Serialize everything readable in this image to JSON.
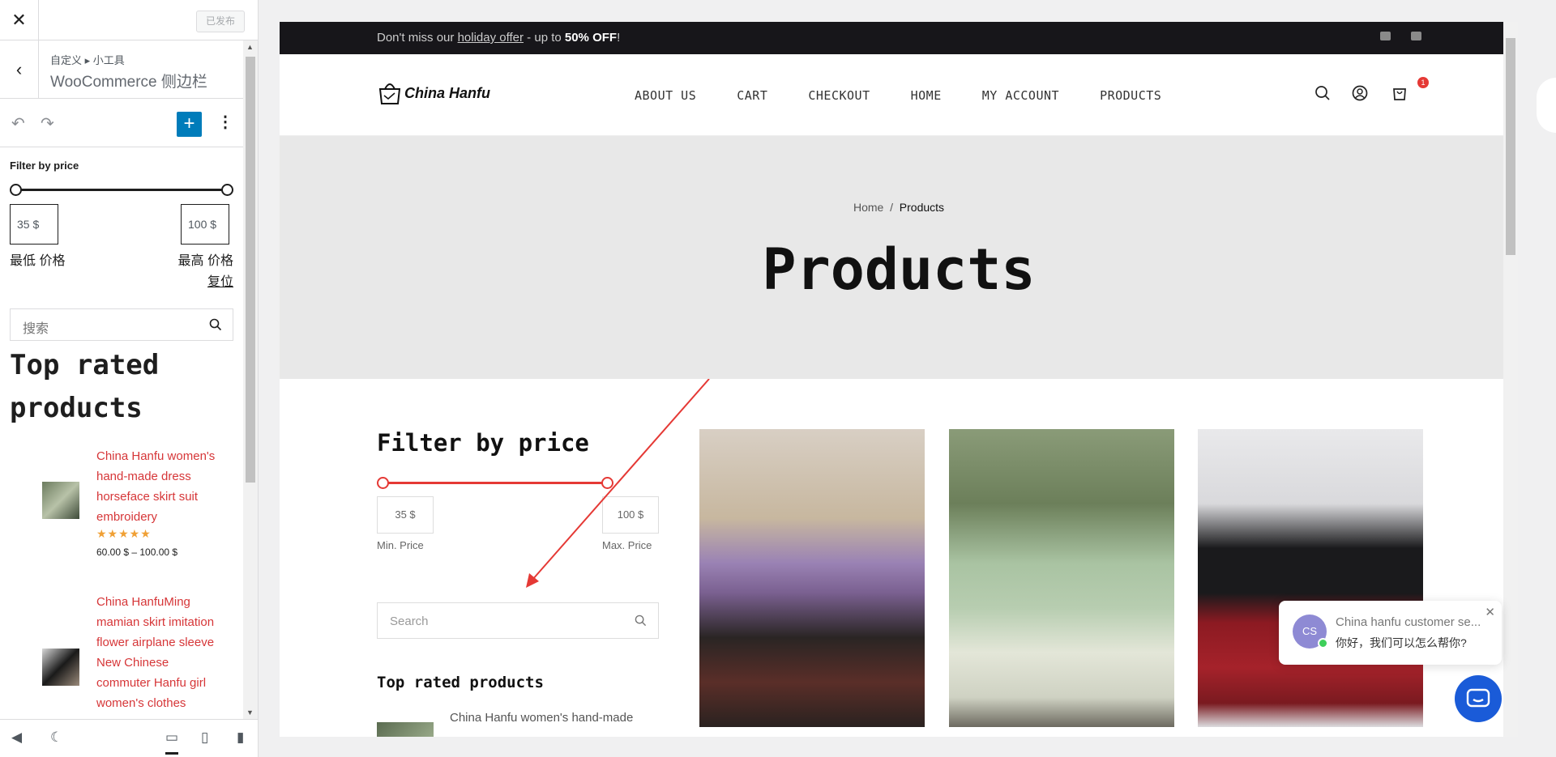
{
  "customizer": {
    "close_icon": "close-icon",
    "published_label": "已发布",
    "breadcrumb": "自定义 ▸ 小工具",
    "section_title": "WooCommerce 侧边栏",
    "filter": {
      "heading": "Filter by price",
      "min_value": "35 $",
      "max_value": "100 $",
      "min_label": "最低 价格",
      "max_label": "最高 价格",
      "reset": "复位"
    },
    "search_placeholder": "搜索",
    "top_rated_heading": "Top rated products",
    "products": [
      {
        "name": "China Hanfu women's hand-made dress horseface skirt suit embroidery",
        "stars": "★★★★★",
        "price": "60.00 $ – 100.00 $"
      },
      {
        "name": "China HanfuMing mamian skirt imitation flower airplane sleeve New Chinese commuter Hanfu girl women's clothes"
      }
    ]
  },
  "site": {
    "promo": {
      "prefix": "Don't miss our ",
      "link": "holiday offer",
      "middle": " - up to ",
      "bold": "50% OFF",
      "suffix": "!"
    },
    "logo_text": "China Hanfu",
    "nav": [
      "ABOUT US",
      "CART",
      "CHECKOUT",
      "HOME",
      "MY ACCOUNT",
      "PRODUCTS"
    ],
    "cart_count": "1",
    "breadcrumb_home": "Home",
    "breadcrumb_sep": "/",
    "breadcrumb_current": "Products",
    "page_title": "Products",
    "filter": {
      "heading": "Filter by price",
      "min_value": "35 $",
      "max_value": "100 $",
      "min_label": "Min. Price",
      "max_label": "Max. Price"
    },
    "search_placeholder": "Search",
    "top_rated_heading": "Top rated products",
    "top_rated_first": "China Hanfu women's hand-made"
  },
  "chat": {
    "avatar": "CS",
    "title": "China hanfu customer se...",
    "message": "你好，我们可以怎么帮你?"
  },
  "colors": {
    "accent": "#e53935",
    "wp_blue": "#007cba",
    "chat_blue": "#1a5bd8"
  }
}
